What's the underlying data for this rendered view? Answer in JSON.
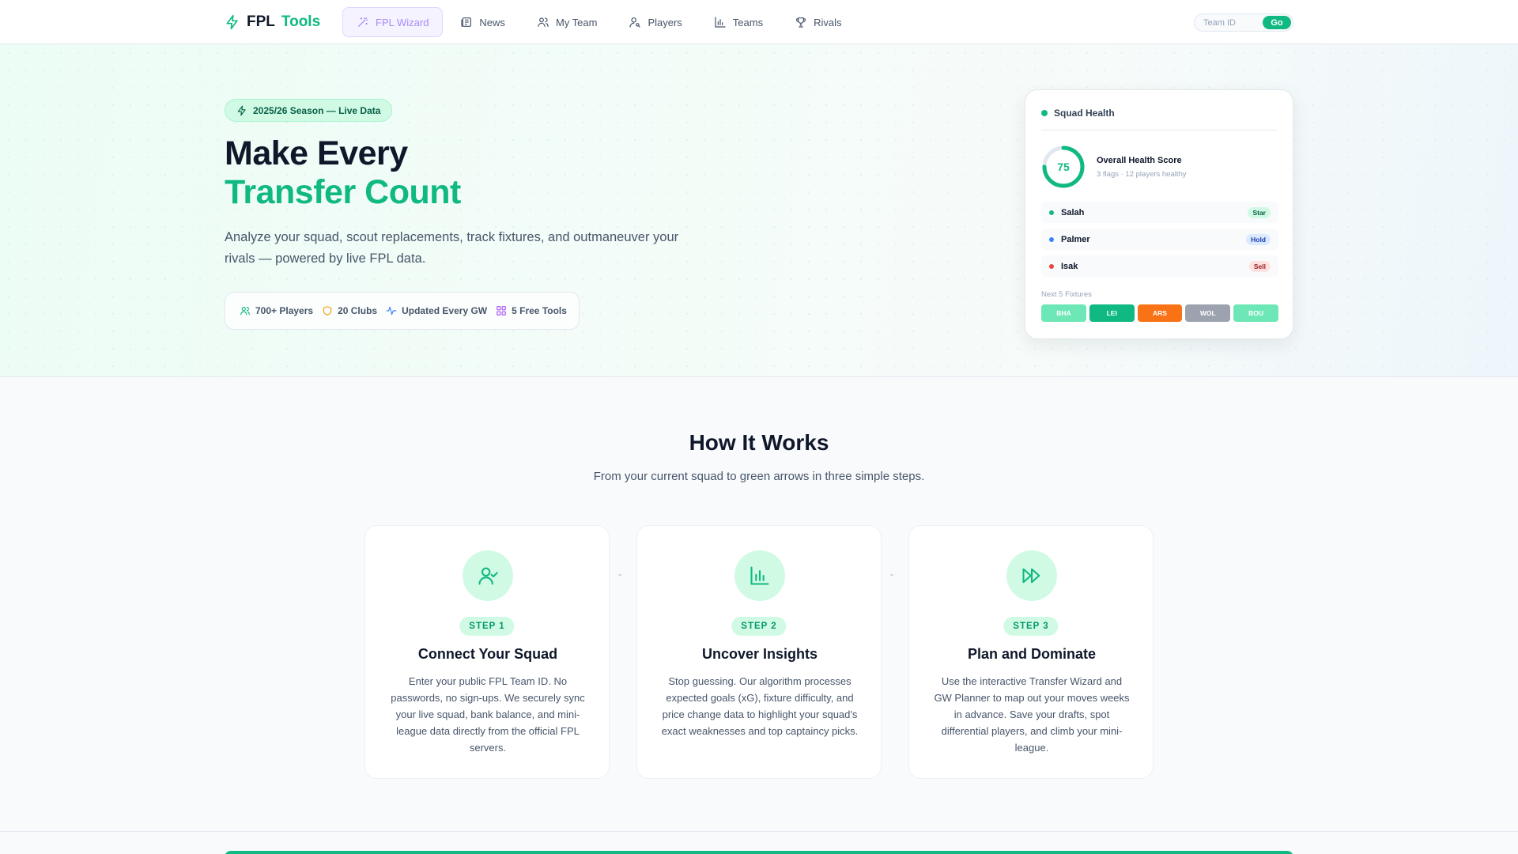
{
  "brand": {
    "name_part1": "FPL",
    "name_part2": "Tools",
    "logo_icon": "lightning-icon"
  },
  "nav": {
    "items": [
      {
        "label": "FPL Wizard",
        "icon": "wand-icon",
        "active": true
      },
      {
        "label": "News",
        "icon": "newspaper-icon",
        "active": false
      },
      {
        "label": "My Team",
        "icon": "users-icon",
        "active": false
      },
      {
        "label": "Players",
        "icon": "user-search-icon",
        "active": false
      },
      {
        "label": "Teams",
        "icon": "bar-chart-icon",
        "active": false
      },
      {
        "label": "Rivals",
        "icon": "trophy-icon",
        "active": false
      }
    ],
    "team_id_placeholder": "Team ID",
    "go_label": "Go"
  },
  "hero": {
    "badge": "2025/26 Season — Live Data",
    "title_line1": "Make Every",
    "title_line2": "Transfer Count",
    "subtitle": "Analyze your squad, scout replacements, track fixtures, and outmaneuver your rivals — powered by live FPL data.",
    "stats": [
      {
        "label": "700+ Players",
        "icon": "users-icon",
        "color": "#10b981"
      },
      {
        "label": "20 Clubs",
        "icon": "shield-icon",
        "color": "#f59e0b"
      },
      {
        "label": "Updated Every GW",
        "icon": "activity-icon",
        "color": "#3b82f6"
      },
      {
        "label": "5 Free Tools",
        "icon": "grid-icon",
        "color": "#a855f7"
      }
    ]
  },
  "squad_card": {
    "title": "Squad Health",
    "score": "75",
    "score_fraction": 0.75,
    "score_title": "Overall Health Score",
    "score_meta": "3 flags · 12 players healthy",
    "players": [
      {
        "name": "Salah",
        "tag": "Star",
        "dot_color": "#10b981",
        "tag_bg": "#d1fae5",
        "tag_color": "#065f46"
      },
      {
        "name": "Palmer",
        "tag": "Hold",
        "dot_color": "#3b82f6",
        "tag_bg": "#dbeafe",
        "tag_color": "#1e40af"
      },
      {
        "name": "Isak",
        "tag": "Sell",
        "dot_color": "#ef4444",
        "tag_bg": "#fee2e2",
        "tag_color": "#991b1b"
      }
    ],
    "next_label": "Next 5 Fixtures",
    "fixtures": [
      {
        "team": "BHA",
        "color": "#6ee7b7"
      },
      {
        "team": "LEI",
        "color": "#10b981"
      },
      {
        "team": "ARS",
        "color": "#f97316"
      },
      {
        "team": "WOL",
        "color": "#9ca3af"
      },
      {
        "team": "BOU",
        "color": "#6ee7b7"
      }
    ]
  },
  "how": {
    "title": "How It Works",
    "subtitle": "From your current squad to green arrows in three simple steps.",
    "steps": [
      {
        "pill": "STEP 1",
        "icon": "user-check-icon",
        "title": "Connect Your Squad",
        "text": "Enter your public FPL Team ID. No passwords, no sign-ups. We securely sync your live squad, bank balance, and mini-league data directly from the official FPL servers."
      },
      {
        "pill": "STEP 2",
        "icon": "bar-chart-icon",
        "title": "Uncover Insights",
        "text": "Stop guessing. Our algorithm processes expected goals (xG), fixture difficulty, and price change data to highlight your squad's exact weaknesses and top captaincy picks."
      },
      {
        "pill": "STEP 3",
        "icon": "fast-forward-icon",
        "title": "Plan and Dominate",
        "text": "Use the interactive Transfer Wizard and GW Planner to map out your moves weeks in advance. Save your drafts, spot differential players, and climb your mini-league."
      }
    ],
    "connector": "-"
  },
  "colors": {
    "accent": "#10b981",
    "text": "#0f172a",
    "muted": "#475569"
  }
}
